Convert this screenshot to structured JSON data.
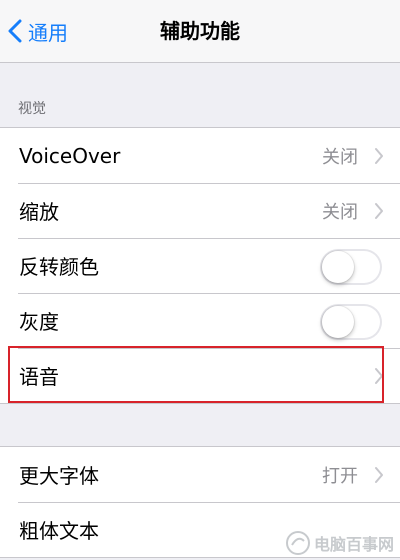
{
  "nav": {
    "back_label": "通用",
    "title": "辅助功能"
  },
  "section_vision": {
    "header": "视觉",
    "rows": [
      {
        "label": "VoiceOver",
        "value": "关闭"
      },
      {
        "label": "缩放",
        "value": "关闭"
      },
      {
        "label": "反转颜色",
        "toggle": "off"
      },
      {
        "label": "灰度",
        "toggle": "off"
      },
      {
        "label": "语音"
      }
    ]
  },
  "section_text": {
    "rows": [
      {
        "label": "更大字体",
        "value": "打开"
      },
      {
        "label": "粗体文本"
      }
    ]
  },
  "watermark": {
    "text": "电脑百事网"
  },
  "colors": {
    "accent": "#157efb",
    "highlight": "#d8232a",
    "background": "#efeff4"
  }
}
